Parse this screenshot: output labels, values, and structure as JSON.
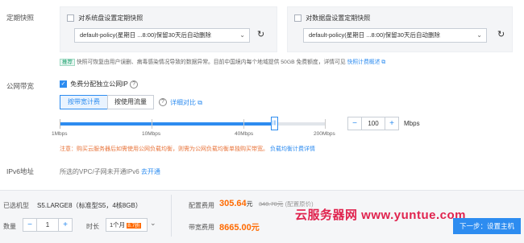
{
  "snapshot": {
    "label": "定期快照",
    "system_disk": {
      "checkbox_label": "对系统盘设置定期快照",
      "policy_value": "default-policy(星期日 ...8:00)保留30天后自动删除"
    },
    "data_disk": {
      "checkbox_label": "对数据盘设置定期快照",
      "policy_value": "default-policy(星期日 ...8:00)保留30天后自动删除"
    },
    "recommend_tag": "推荐",
    "notice_text": "快照可恢复由用户误删、病毒感染情况导致的数据异常。目前中国境内每个地域提供 50GB 免费额度，详情可见",
    "notice_link": "快照计费概述"
  },
  "bandwidth": {
    "label": "公网带宽",
    "assign_ip_label": "免费分配独立公网IP",
    "tab_bandwidth": "按带宽计费",
    "tab_traffic": "按使用流量",
    "detail_link": "详细对比",
    "ticks": [
      "1Mbps",
      "10Mbps",
      "40Mbps",
      "200Mbps"
    ],
    "value": "100",
    "unit": "Mbps",
    "level_mbps": 100,
    "minus": "−",
    "plus": "+",
    "warning_text": "注意：购买云服务器后如需使用公网负载均衡，则需为公网负载均衡单独购买带宽。",
    "warning_link": "负载均衡计费详情"
  },
  "ipv6": {
    "label": "IPv6地址",
    "text": "所选的VPC/子网未开通IPv6",
    "link": "去开通"
  },
  "footer": {
    "model_label": "已选机型",
    "model_value": "S5.LARGE8（标准型S5，4核8GB）",
    "qty_label": "数量",
    "qty_value": "1",
    "duration_label": "时长",
    "duration_value": "1个月",
    "discount": "8.7折",
    "config_fee_label": "配置费用",
    "config_fee": "305.64",
    "config_fee_unit": "元",
    "original_price": "348.70元",
    "original_note": "(配置原价)",
    "bandwidth_fee_label": "带宽费用",
    "bandwidth_fee": "8665.00",
    "bandwidth_fee_unit": "元",
    "next_button": "下一步：设置主机",
    "watermark": "云服务器网 www.yuntue.com"
  },
  "colors": {
    "accent": "#2d8cf0",
    "price": "#ff6a00",
    "warning": "#e8743b",
    "watermark": "#e0234e"
  }
}
